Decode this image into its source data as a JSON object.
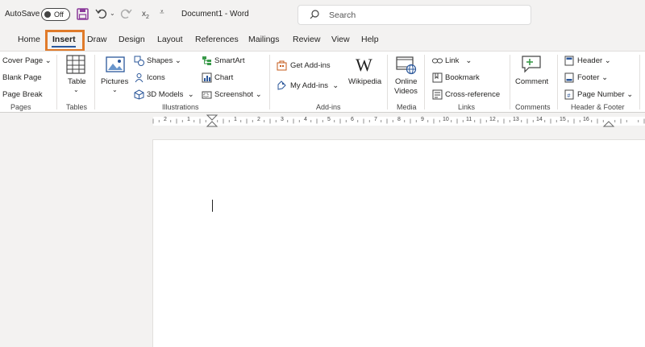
{
  "titlebar": {
    "autosave_label": "AutoSave",
    "autosave_state": "Off",
    "doc_title": "Document1  -  Word",
    "search_placeholder": "Search"
  },
  "tabs": [
    "Home",
    "Insert",
    "Draw",
    "Design",
    "Layout",
    "References",
    "Mailings",
    "Review",
    "View",
    "Help"
  ],
  "active_tab": "Insert",
  "ribbon": {
    "pages": {
      "cover_page": "Cover Page",
      "blank_page": "Blank Page",
      "page_break": "Page Break",
      "label": "Pages"
    },
    "tables": {
      "table": "Table",
      "label": "Tables"
    },
    "illustrations": {
      "pictures": "Pictures",
      "shapes": "Shapes",
      "icons": "Icons",
      "models": "3D Models",
      "smartart": "SmartArt",
      "chart": "Chart",
      "screenshot": "Screenshot",
      "label": "Illustrations"
    },
    "addins": {
      "get": "Get Add-ins",
      "my": "My Add-ins",
      "wikipedia": "Wikipedia",
      "label": "Add-ins"
    },
    "media": {
      "online_videos_1": "Online",
      "online_videos_2": "Videos",
      "label": "Media"
    },
    "links": {
      "link": "Link",
      "bookmark": "Bookmark",
      "cross_reference": "Cross-reference",
      "label": "Links"
    },
    "comments": {
      "comment": "Comment",
      "label": "Comments"
    },
    "header_footer": {
      "header": "Header",
      "footer": "Footer",
      "page_number": "Page Number",
      "label": "Header & Footer"
    }
  },
  "ruler": {
    "numbers": [
      "1",
      "2",
      "3",
      "4",
      "5",
      "6",
      "7",
      "8",
      "9",
      "10",
      "11",
      "12",
      "13",
      "14",
      "15",
      "16"
    ]
  },
  "colors": {
    "accent": "#2b579a",
    "highlight": "#e07b2a",
    "save_icon": "#8b3a9a"
  }
}
